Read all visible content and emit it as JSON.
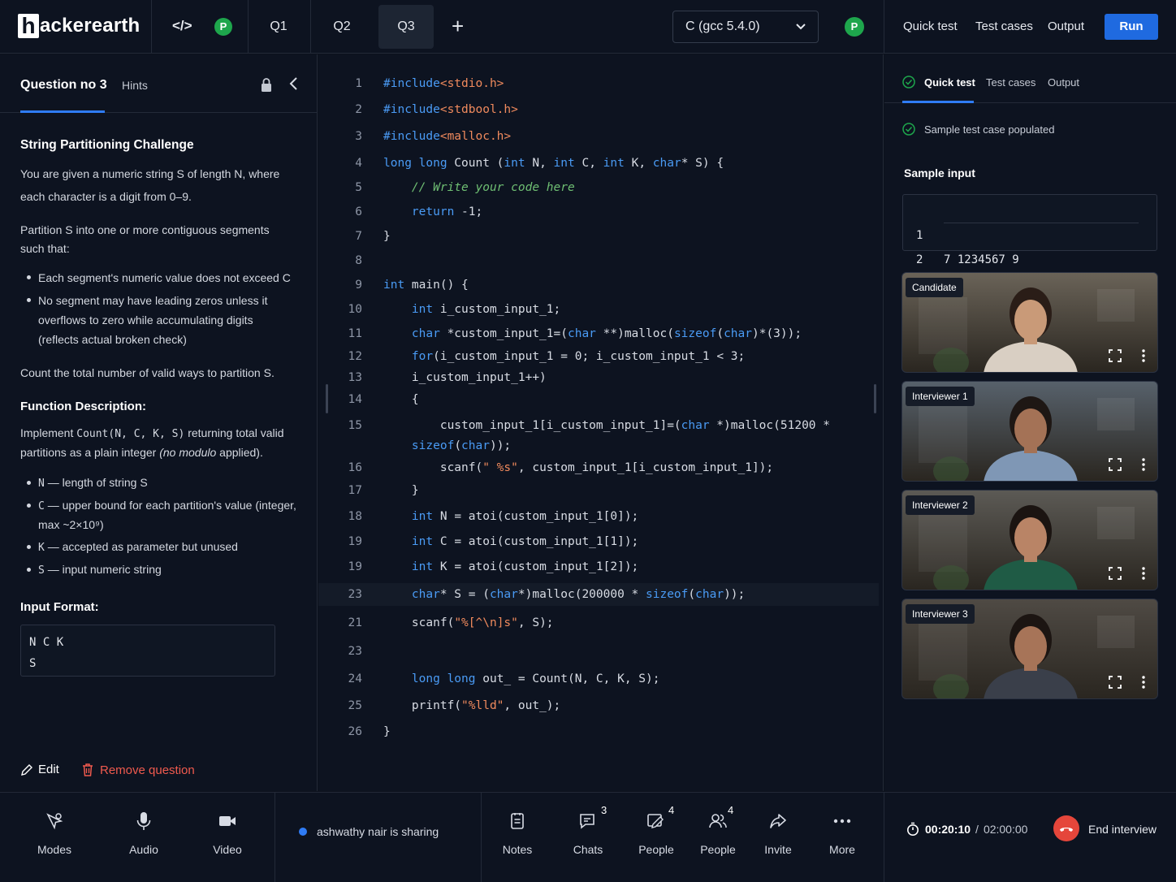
{
  "topbar": {
    "logo_letter": "h",
    "logo_text": "ackerearth",
    "code_symbol": "</>",
    "presence_badge": "P",
    "tabs": [
      "Q1",
      "Q2",
      "Q3"
    ],
    "active_tab": "Q3",
    "add_symbol": "+",
    "language": "C (gcc 5.4.0)",
    "links": [
      "Quick test",
      "Test cases",
      "Output"
    ],
    "run_label": "Run",
    "accent_color": "#1f6ae0",
    "presence_color": "#1ea64c"
  },
  "question": {
    "tab_label": "Question no 3",
    "hints_label": "Hints",
    "title": "String Partitioning Challenge",
    "intro": "You are given a numeric string S of length N, where each character is a digit from 0–9.",
    "partition_intro": "Partition S into one or more contiguous segments such that:",
    "rules": [
      "Each segment's numeric value does not exceed C",
      "No segment may have leading zeros unless it overflows to zero while accumulating digits (reflects actual broken check)"
    ],
    "count_text": "Count the total number of valid ways to partition S.",
    "function_heading": "Function Description:",
    "function_pre": "Implement",
    "function_signature": "Count(N, C, K, S)",
    "function_post": "returning total valid partitions as a plain integer",
    "function_italic": "(no modulo",
    "function_end": "applied).",
    "params": [
      {
        "name": "N",
        "desc": "— length of string S"
      },
      {
        "name": "C",
        "desc": "— upper bound for each partition's value (integer, max ~2×10⁹)"
      },
      {
        "name": "K",
        "desc": "— accepted as parameter but unused"
      },
      {
        "name": "S",
        "desc": "— input numeric string"
      }
    ],
    "input_format_heading": "Input Format:",
    "input_format_lines": [
      "N C K",
      "S"
    ],
    "edit_label": "Edit",
    "remove_label": "Remove question",
    "remove_color": "#f05a4e"
  },
  "editor": {
    "lines": [
      {
        "num": "1",
        "html": "<span class=\"k\">#include</span><span class=\"s\">&lt;stdio.h&gt;</span>"
      },
      {
        "num": "2",
        "html": "<span class=\"k\">#include</span><span class=\"s\">&lt;stdbool.h&gt;</span>"
      },
      {
        "num": "3",
        "html": "<span class=\"k\">#include</span><span class=\"s\">&lt;malloc.h&gt;</span>"
      },
      {
        "num": "4",
        "html": "<span class=\"k\">long long</span> Count (<span class=\"k\">int</span> N, <span class=\"k\">int</span> C, <span class=\"k\">int</span> K, <span class=\"k\">char</span>* S) {"
      },
      {
        "num": "5",
        "html": "    <span class=\"c\">// Write your code here</span>"
      },
      {
        "num": "6",
        "html": "    <span class=\"k\">return</span> -1;"
      },
      {
        "num": "7",
        "html": "}"
      },
      {
        "num": "8",
        "html": ""
      },
      {
        "num": "9",
        "html": "<span class=\"k\">int</span> main() {"
      },
      {
        "num": "10",
        "html": "    <span class=\"k\">int</span> i_custom_input_1;"
      },
      {
        "num": "11",
        "html": "    <span class=\"k\">char</span> *custom_input_1=(<span class=\"k\">char</span> **)malloc(<span class=\"k\">sizeof</span>(<span class=\"k\">char</span>)*(3));"
      },
      {
        "num": "12",
        "html": "    <span class=\"k\">for</span>(i_custom_input_1 = 0; i_custom_input_1 &lt; 3;"
      },
      {
        "num": "13",
        "html": "    i_custom_input_1++)"
      },
      {
        "num": "14",
        "html": "    {"
      },
      {
        "num": "15",
        "html": "        custom_input_1[i_custom_input_1]=(<span class=\"k\">char</span> *)malloc(51200 *"
      },
      {
        "num": "",
        "html": "    <span class=\"k\">sizeof</span>(<span class=\"k\">char</span>));"
      },
      {
        "num": "16",
        "html": "        scanf(<span class=\"s\">\" %s\"</span>, custom_input_1[i_custom_input_1]);"
      },
      {
        "num": "17",
        "html": "    }"
      },
      {
        "num": "18",
        "html": "    <span class=\"k\">int</span> N = atoi(custom_input_1[0]);"
      },
      {
        "num": "19",
        "html": "    <span class=\"k\">int</span> C = atoi(custom_input_1[1]);"
      },
      {
        "num": "19",
        "html": "    <span class=\"k\">int</span> K = atoi(custom_input_1[2]);"
      },
      {
        "num": "23",
        "html": "    <span class=\"k\">char</span>* S = (<span class=\"k\">char</span>*)malloc(200000 * <span class=\"k\">sizeof</span>(<span class=\"k\">char</span>));"
      },
      {
        "num": "21",
        "html": "    scanf(<span class=\"s\">\"%[^\\n]s\"</span>, S);"
      },
      {
        "num": "23",
        "html": ""
      },
      {
        "num": "24",
        "html": "    <span class=\"k\">long long</span> out_ = Count(N, C, K, S);"
      },
      {
        "num": "25",
        "html": "    printf(<span class=\"s\">\"%lld\"</span>, out_);"
      },
      {
        "num": "26",
        "html": "}"
      }
    ],
    "highlighted_line_index": 21
  },
  "rightpanel": {
    "tabs": [
      "Quick test",
      "Test cases",
      "Output"
    ],
    "active_tab": "Quick test",
    "status": "Sample test case populated",
    "sample_heading": "Sample input",
    "sample_lines": [
      {
        "num": "1",
        "text": "7 1234567 9"
      },
      {
        "num": "2",
        "text": "1234567"
      }
    ]
  },
  "videos": [
    {
      "label": "Candidate",
      "skin": "#c99a78",
      "hair": "#2a1d17",
      "shirt": "#d9cfc3",
      "bg": "#6a6358"
    },
    {
      "label": "Interviewer 1",
      "skin": "#a47256",
      "hair": "#1e1714",
      "shirt": "#7f97b5",
      "bg": "#57616b"
    },
    {
      "label": "Interviewer 2",
      "skin": "#b98466",
      "hair": "#1b1411",
      "shirt": "#1f5b45",
      "bg": "#5c5a55"
    },
    {
      "label": "Interviewer 3",
      "skin": "#a77458",
      "hair": "#1c1512",
      "shirt": "#3a3f4a",
      "bg": "#4f4a44"
    }
  ],
  "bottombar": {
    "left_items": [
      {
        "label": "Modes",
        "icon": "modes-icon"
      },
      {
        "label": "Audio",
        "icon": "microphone-icon"
      },
      {
        "label": "Video",
        "icon": "camera-icon"
      }
    ],
    "sharing_text": "ashwathy nair is sharing",
    "center_items": [
      {
        "label": "Notes",
        "icon": "notes-icon",
        "badge": ""
      },
      {
        "label": "Chats",
        "icon": "chat-icon",
        "badge": "3"
      },
      {
        "label": "People",
        "icon": "edit-people-icon",
        "badge": "4"
      },
      {
        "label": "People",
        "icon": "people-icon",
        "badge": "4"
      },
      {
        "label": "Invite",
        "icon": "share-icon",
        "badge": ""
      },
      {
        "label": "More",
        "icon": "more-icon",
        "badge": ""
      }
    ],
    "timer_elapsed": "00:20:10",
    "timer_sep": "/",
    "timer_total": "02:00:00",
    "end_label": "End interview"
  }
}
